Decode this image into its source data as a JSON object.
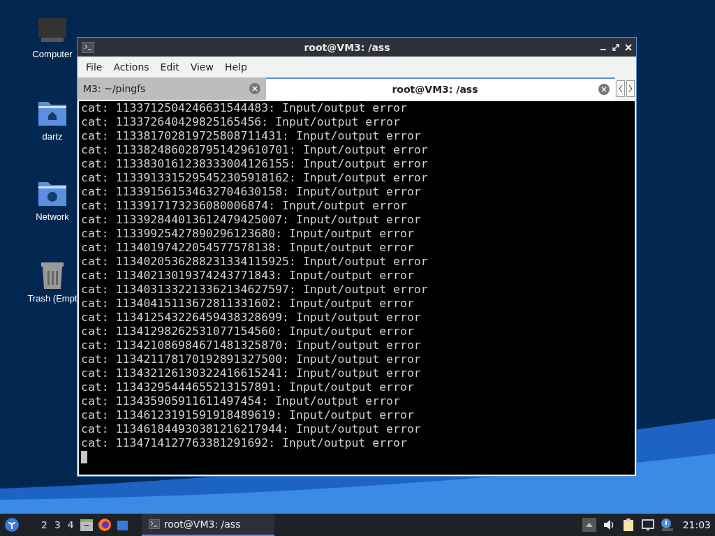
{
  "desktop_icons": [
    {
      "kind": "computer",
      "label": "Computer"
    },
    {
      "kind": "home",
      "label": "dartz"
    },
    {
      "kind": "network",
      "label": "Network"
    },
    {
      "kind": "trash",
      "label": "Trash (Empt"
    }
  ],
  "window": {
    "title": "root@VM3: /ass",
    "menu": [
      "File",
      "Actions",
      "Edit",
      "View",
      "Help"
    ],
    "tabs": [
      {
        "label": "M3: ~/pingfs",
        "selected": false
      },
      {
        "label": "root@VM3: /ass",
        "selected": true
      }
    ],
    "lines": [
      "cat: 1133712504246631544483: Input/output error",
      "cat: 113372640429825165456: Input/output error",
      "cat: 113381702819725808711431: Input/output error",
      "cat: 1133824860287951429610701: Input/output error",
      "cat: 1133830161238333004126155: Input/output error",
      "cat: 1133913315295452305918162: Input/output error",
      "cat: 113391561534632704630158: Input/output error",
      "cat: 1133917173236080006874: Input/output error",
      "cat: 113392844013612479425007: Input/output error",
      "cat: 11339925427890296123680: Input/output error",
      "cat: 11340197422054577578138: Input/output error",
      "cat: 1134020536288231334115925: Input/output error",
      "cat: 11340213019374243771843: Input/output error",
      "cat: 1134031332213362134627597: Input/output error",
      "cat: 11340415113672811331602: Input/output error",
      "cat: 113412543226459438328699: Input/output error",
      "cat: 11341298262531077154560: Input/output error",
      "cat: 113421086984671481325870: Input/output error",
      "cat: 113421178170192891327500: Input/output error",
      "cat: 113432126130322416615241: Input/output error",
      "cat: 11343295444655213157891: Input/output error",
      "cat: 113435905911611497454: Input/output error",
      "cat: 11346123191591918489619: Input/output error",
      "cat: 113461844930381216217944: Input/output error",
      "cat: 1134714127763381291692: Input/output error"
    ]
  },
  "taskbar": {
    "workspaces": [
      "2",
      "3",
      "4"
    ],
    "launchers": [
      {
        "kind": "files"
      },
      {
        "kind": "browser"
      },
      {
        "kind": "square"
      }
    ],
    "tasks": [
      {
        "label": "root@VM3: /ass",
        "selected": true
      }
    ],
    "clock": "21:03"
  }
}
